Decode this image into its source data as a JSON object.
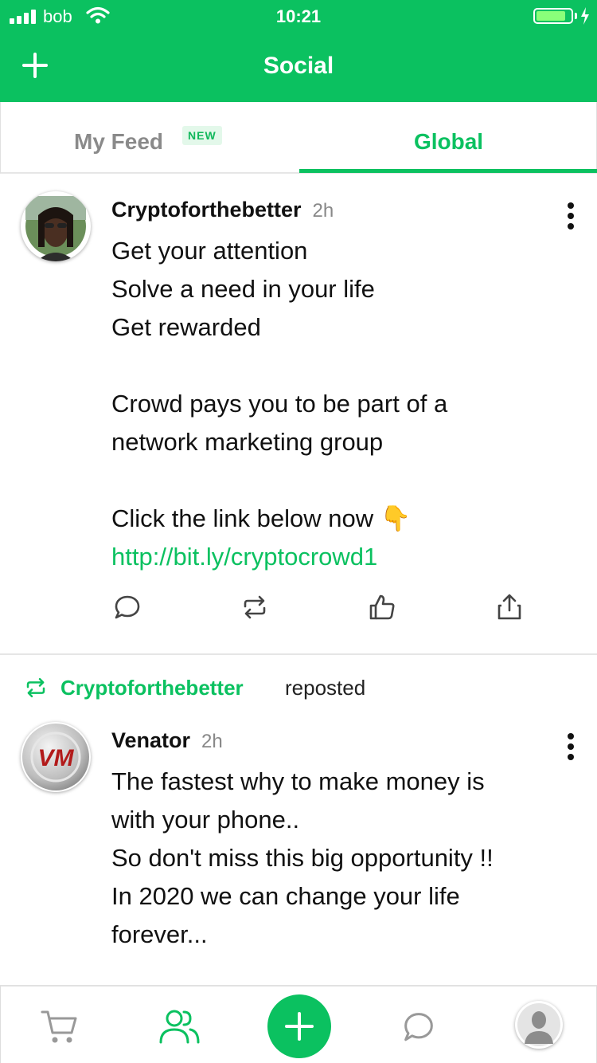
{
  "status_bar": {
    "carrier": "bob",
    "time": "10:21",
    "battery_level": 0.85,
    "battery_color": "#8aff7a"
  },
  "header": {
    "title": "Social",
    "add_icon": "plus-icon",
    "background": "#0bc160"
  },
  "tabs": {
    "my_feed": {
      "label": "My Feed",
      "badge": "NEW"
    },
    "global": {
      "label": "Global",
      "active": true
    }
  },
  "posts": [
    {
      "username": "Cryptoforthebetter",
      "time": "2h",
      "lines": "Get your attention\nSolve a need in your life\nGet rewarded\n\nCrowd pays you to be part of a\nnetwork marketing group\n\nClick the link below now 👇",
      "link": "http://bit.ly/cryptocrowd1",
      "actions": [
        "comment-icon",
        "repost-icon",
        "like-icon",
        "share-icon"
      ]
    },
    {
      "repost_by": "Cryptoforthebetter",
      "repost_verb": "reposted",
      "username": "Venator",
      "avatar_text": "VM",
      "time": "2h",
      "lines": "The fastest why to make money is\nwith your phone..\nSo don't miss this big opportunity !!\nIn 2020 we can change your life\nforever..."
    }
  ],
  "bottom_nav": {
    "items": [
      "cart-icon",
      "people-icon",
      "plus-icon",
      "chat-icon",
      "profile-avatar"
    ],
    "active": "people-icon"
  }
}
